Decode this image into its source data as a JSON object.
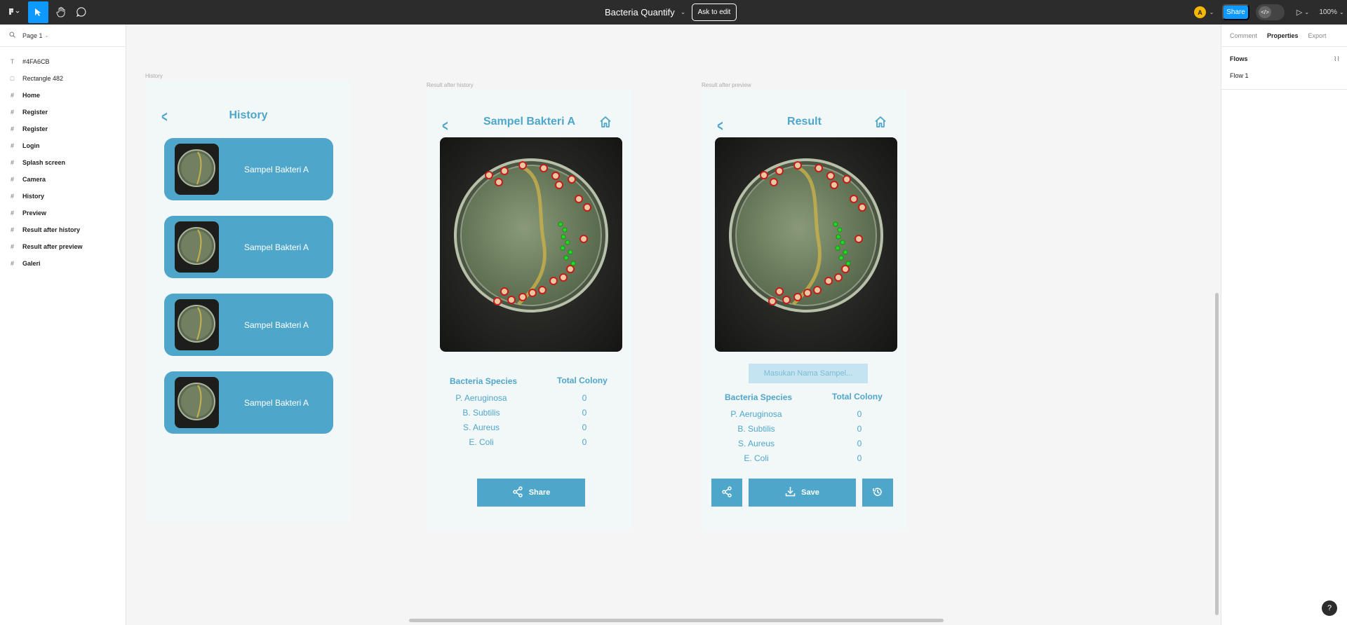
{
  "topbar": {
    "file_title": "Bacteria Quantify",
    "ask_edit_label": "Ask to edit",
    "avatar_letter": "A",
    "share_label": "Share",
    "zoom_level": "100%"
  },
  "left_panel": {
    "page_name": "Page 1",
    "layers": [
      {
        "label": "#4FA6CB",
        "icon": "text-icon"
      },
      {
        "label": "Rectangle 482",
        "icon": "rectangle-icon"
      },
      {
        "label": "Home",
        "icon": "frame-icon"
      },
      {
        "label": "Register",
        "icon": "frame-icon"
      },
      {
        "label": "Register",
        "icon": "frame-icon"
      },
      {
        "label": "Login",
        "icon": "frame-icon"
      },
      {
        "label": "Splash screen",
        "icon": "frame-icon"
      },
      {
        "label": "Camera",
        "icon": "frame-icon"
      },
      {
        "label": "History",
        "icon": "frame-icon"
      },
      {
        "label": "Preview",
        "icon": "frame-icon"
      },
      {
        "label": "Result after history",
        "icon": "frame-icon"
      },
      {
        "label": "Result after preview",
        "icon": "frame-icon"
      },
      {
        "label": "Galeri",
        "icon": "frame-icon"
      }
    ]
  },
  "right_panel": {
    "tabs": [
      "Comment",
      "Properties",
      "Export"
    ],
    "active_tab": "Properties",
    "flows_heading": "Flows",
    "flow_item": "Flow 1",
    "help": "?"
  },
  "frames": {
    "history": {
      "frame_label": "History",
      "title": "History",
      "cards": [
        "Sampel Bakteri A",
        "Sampel Bakteri A",
        "Sampel Bakteri A",
        "Sampel Bakteri A"
      ]
    },
    "result_history": {
      "frame_label": "Result after history",
      "title": "Sampel Bakteri A",
      "species_header": "Bacteria Species",
      "colony_header": "Total Colony",
      "rows": [
        {
          "name": "P. Aeruginosa",
          "value": "0"
        },
        {
          "name": "B. Subtilis",
          "value": "0"
        },
        {
          "name": "S. Aureus",
          "value": "0"
        },
        {
          "name": "E. Coli",
          "value": "0"
        }
      ],
      "share_label": "Share"
    },
    "result_preview": {
      "frame_label": "Result after preview",
      "title": "Result",
      "input_placeholder": "Masukan Nama Sampel...",
      "species_header": "Bacteria Species",
      "colony_header": "Total Colony",
      "rows": [
        {
          "name": "P. Aeruginosa",
          "value": "0"
        },
        {
          "name": "B. Subtilis",
          "value": "0"
        },
        {
          "name": "S. Aureus",
          "value": "0"
        },
        {
          "name": "E. Coli",
          "value": "0"
        }
      ],
      "save_label": "Save"
    }
  },
  "colors": {
    "accent": "#4FA6CB",
    "figma_blue": "#0D99FF",
    "topbar_bg": "#2C2C2C"
  }
}
